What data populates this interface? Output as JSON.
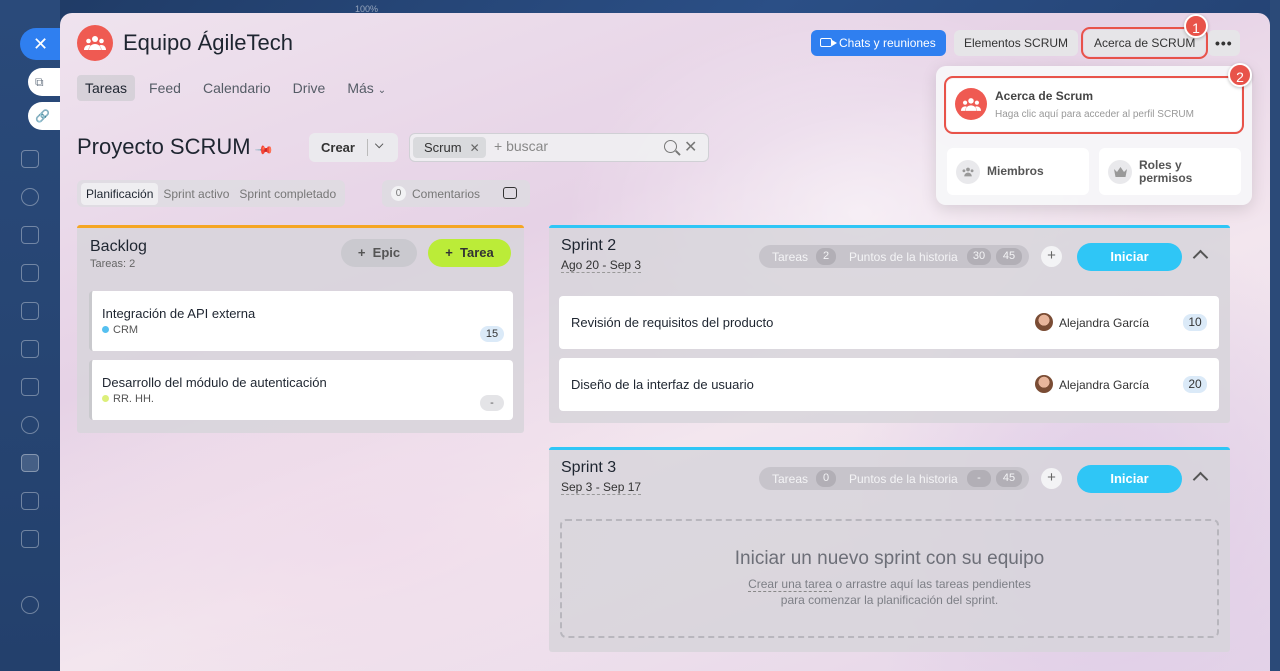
{
  "window": {
    "zoom": "100%"
  },
  "group": {
    "title": "Equipo ÁgileTech"
  },
  "header_buttons": {
    "chats": "Chats y reuniones",
    "elementos": "Elementos SCRUM",
    "acerca": "Acerca de SCRUM",
    "more": "•••"
  },
  "callouts": {
    "first": "1",
    "second": "2"
  },
  "tabs": [
    {
      "label": "Tareas"
    },
    {
      "label": "Feed"
    },
    {
      "label": "Calendario"
    },
    {
      "label": "Drive"
    },
    {
      "label": "Más"
    }
  ],
  "project": {
    "title": "Proyecto SCRUM",
    "create_label": "Crear",
    "filter_chip": "Scrum",
    "search_placeholder": "+ buscar"
  },
  "subtabs": [
    {
      "label": "Planificación"
    },
    {
      "label": "Sprint activo"
    },
    {
      "label": "Sprint completado"
    }
  ],
  "comments": {
    "count": "0",
    "label": "Comentarios"
  },
  "backlog": {
    "title": "Backlog",
    "count_label": "Tareas: 2",
    "epic_label": "Epic",
    "task_label": "Tarea",
    "items": [
      {
        "name": "Integración de API externa",
        "tag": "CRM",
        "tag_color": "#55c0f0",
        "points": "15"
      },
      {
        "name": "Desarrollo del módulo de autenticación",
        "tag": "RR. HH.",
        "tag_color": "#dcef7a",
        "points": "-"
      }
    ]
  },
  "sprints": [
    {
      "title": "Sprint 2",
      "dates": "Ago 20 - Sep 3",
      "tasks_label": "Tareas",
      "tasks_count": "2",
      "story_points_label": "Puntos de la historia",
      "points_done": "30",
      "points_total": "45",
      "start_label": "Iniciar",
      "tasks": [
        {
          "name": "Revisión de requisitos del producto",
          "assignee": "Alejandra García",
          "points": "10"
        },
        {
          "name": "Diseño de la interfaz de usuario",
          "assignee": "Alejandra García",
          "points": "20"
        }
      ]
    },
    {
      "title": "Sprint 3",
      "dates": "Sep 3 - Sep 17",
      "tasks_label": "Tareas",
      "tasks_count": "0",
      "story_points_label": "Puntos de la historia",
      "points_done": "-",
      "points_total": "45",
      "start_label": "Iniciar",
      "empty": {
        "title": "Iniciar un nuevo sprint con su equipo",
        "link_text": "Crear una tarea",
        "line1_rest": " o arrastre aquí las tareas pendientes",
        "line2": "para comenzar la planificación del sprint."
      }
    }
  ],
  "about_menu": {
    "main_title": "Acerca de Scrum",
    "main_desc": "Haga clic aquí para acceder al perfil SCRUM",
    "members_label": "Miembros",
    "roles_label": "Roles y permisos"
  },
  "colors": {
    "accent": "#2f7ff0",
    "brand_red": "#ef5a52",
    "sprint_blue": "#2fc6f6",
    "backlog_orange": "#f5a623",
    "task_green": "#bbec38",
    "highlight": "#e8534a"
  }
}
